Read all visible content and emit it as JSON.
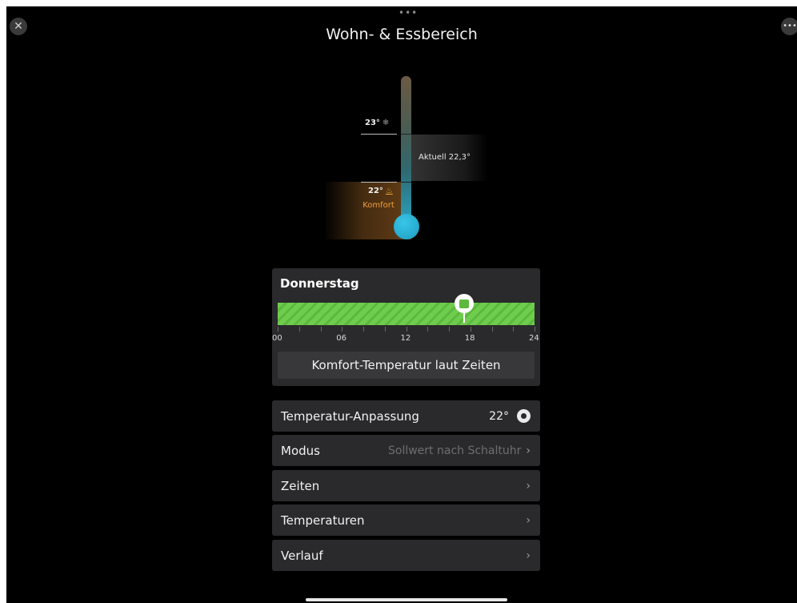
{
  "header": {
    "grabber": "•••",
    "title": "Wohn- & Essbereich",
    "close_icon": "close-icon",
    "more_icon": "more-icon",
    "close_glyph": "✕",
    "more_glyph": "•••"
  },
  "thermometer": {
    "upper_setpoint": "23°",
    "upper_icon_glyph": "❄",
    "lower_setpoint": "22°",
    "lower_icon_glyph": "♨",
    "mode_label": "Komfort",
    "current_label": "Aktuell 22,3°",
    "colors": {
      "tube_top": "#6a5a44",
      "tube_bottom": "#2aa3bf",
      "comfort": "#f0a038"
    }
  },
  "schedule": {
    "day": "Donnerstag",
    "axis_labels": [
      "00",
      "06",
      "12",
      "18",
      "24"
    ],
    "bar_color": "#6fcd4d",
    "current_marker_hour": 17.5,
    "description": "Komfort-Temperatur laut Zeiten"
  },
  "rows": [
    {
      "label": "Temperatur-Anpassung",
      "value": "22°"
    },
    {
      "label": "Modus",
      "value": "Sollwert nach Schaltuhr"
    },
    {
      "label": "Zeiten"
    },
    {
      "label": "Temperaturen"
    },
    {
      "label": "Verlauf"
    }
  ],
  "chevron": "›"
}
